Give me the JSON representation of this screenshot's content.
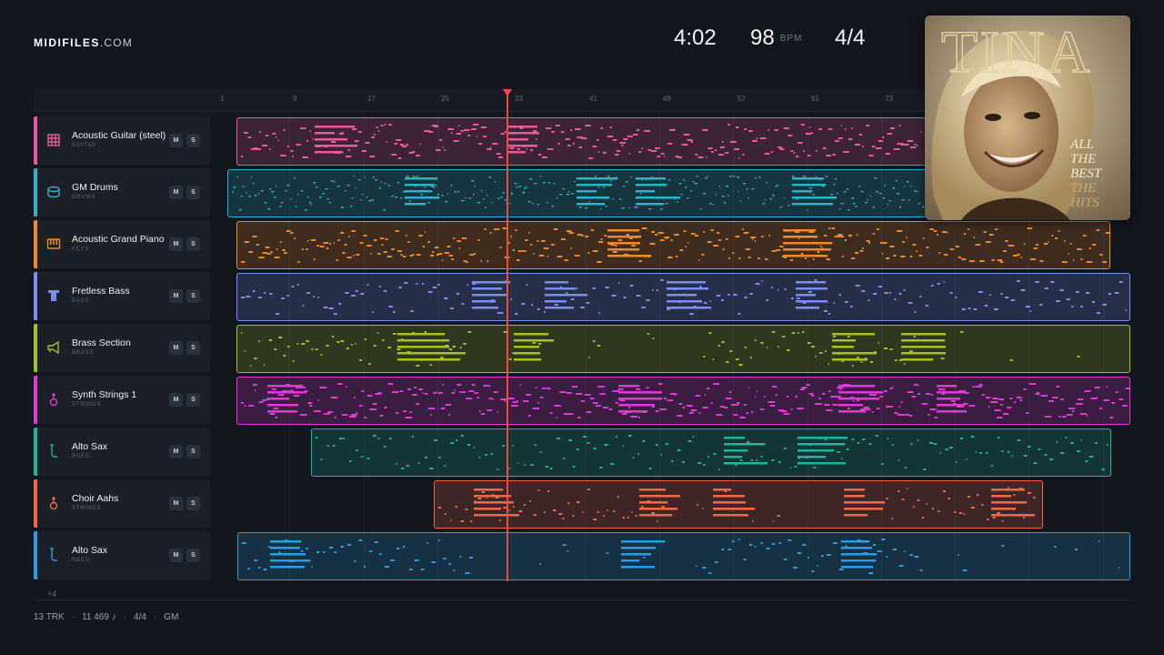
{
  "brand": {
    "bold": "MIDIFILES",
    "light": ".COM"
  },
  "stats": {
    "time": "4:02",
    "bpm": "98",
    "bpm_unit": "BPM",
    "signature": "4/4"
  },
  "ruler": [
    "1",
    "9",
    "17",
    "25",
    "33",
    "41",
    "49",
    "57",
    "65",
    "73"
  ],
  "tracks": [
    {
      "name": "Acoustic Guitar (steel)",
      "category": "GUITAR",
      "color": "#e85b9a",
      "icon": "guitar-icon"
    },
    {
      "name": "GM Drums",
      "category": "DRUMS",
      "color": "#2bb3c9",
      "icon": "drum-icon"
    },
    {
      "name": "Acoustic Grand Piano",
      "category": "KEYS",
      "color": "#f0892a",
      "icon": "piano-icon"
    },
    {
      "name": "Fretless Bass",
      "category": "BASS",
      "color": "#7b8ff0",
      "icon": "bass-icon"
    },
    {
      "name": "Brass Section",
      "category": "BRASS",
      "color": "#a7c024",
      "icon": "horn-icon"
    },
    {
      "name": "Synth Strings 1",
      "category": "STRINGS",
      "color": "#e03ad6",
      "icon": "violin-icon"
    },
    {
      "name": "Alto Sax",
      "category": "REED",
      "color": "#1fb59a",
      "icon": "sax-icon"
    },
    {
      "name": "Choir Aahs",
      "category": "STRINGS",
      "color": "#f2684a",
      "icon": "violin-icon"
    },
    {
      "name": "Alto Sax",
      "category": "REED",
      "color": "#2a9ee0",
      "icon": "sax-icon"
    }
  ],
  "mute_label": "M",
  "solo_label": "S",
  "more_tracks": "+4",
  "footer": {
    "tracks": "13 TRK",
    "notes": "11 469 ♪",
    "signature": "4/4",
    "standard": "GM"
  },
  "album": {
    "artist": "TINA",
    "title_lines": [
      "ALL",
      "THE",
      "BEST",
      "THE",
      "HITS"
    ]
  }
}
